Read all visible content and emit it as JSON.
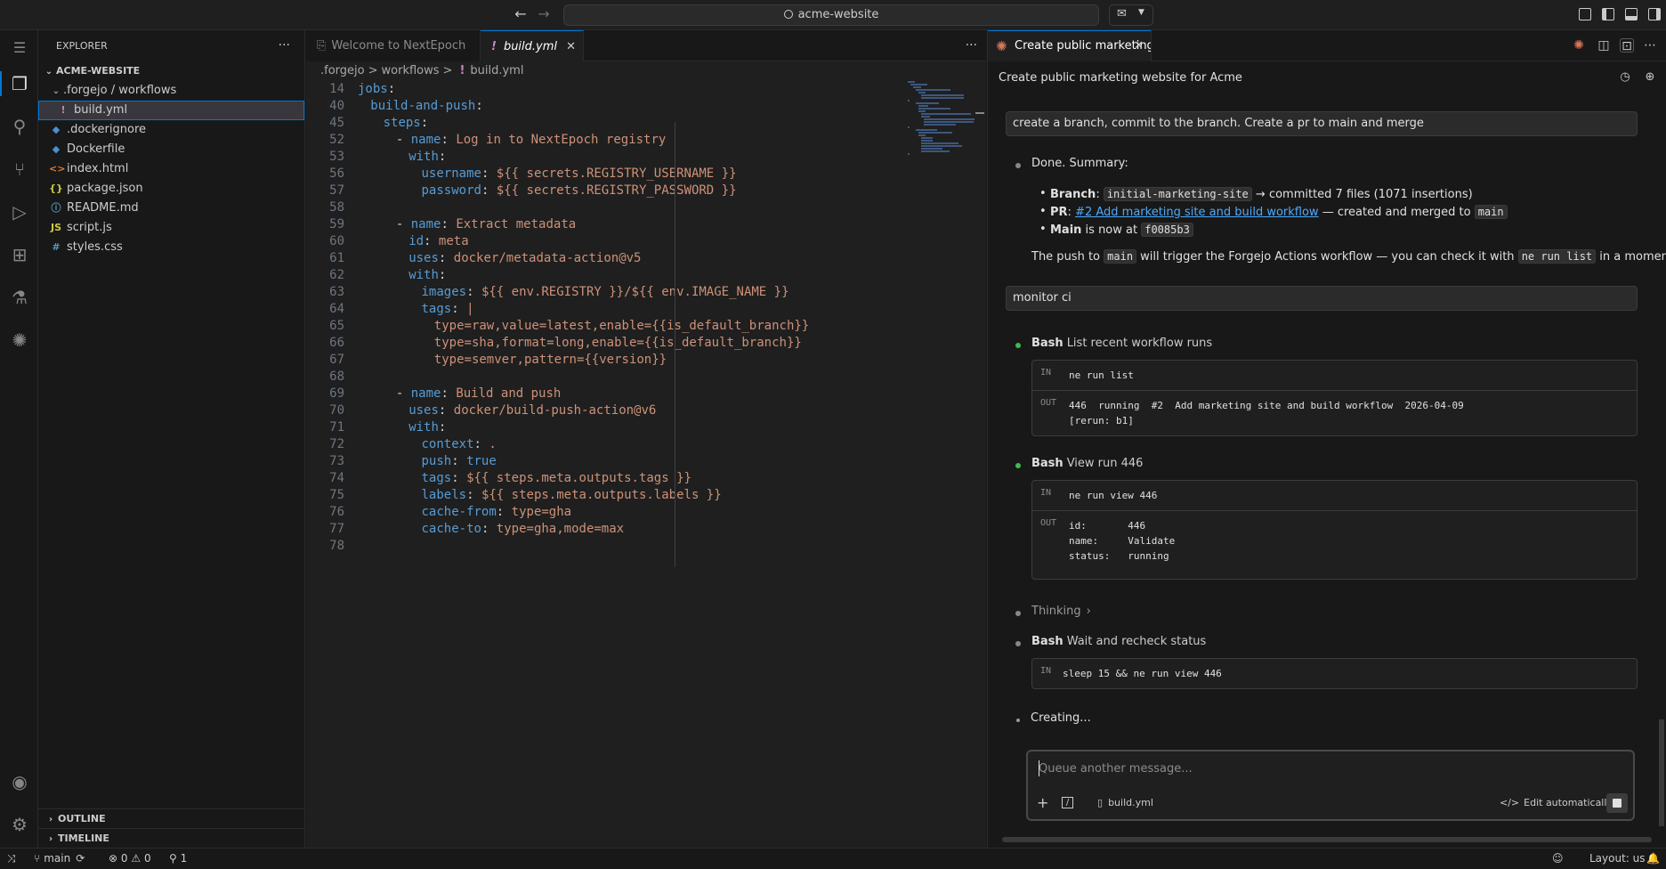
{
  "titlebar": {
    "back_icon": "arrow-left-icon",
    "forward_icon": "arrow-right-icon",
    "search_text": "acme-website"
  },
  "sidebar": {
    "header": "EXPLORER",
    "more_label": "···",
    "root": "ACME-WEBSITE",
    "folder": ".forgejo / workflows",
    "files": [
      {
        "name": "build.yml",
        "icon": "!",
        "color": "#c586c0"
      },
      {
        "name": ".dockerignore",
        "icon": "◆",
        "color": "#4a8fcf"
      },
      {
        "name": "Dockerfile",
        "icon": "◆",
        "color": "#4a8fcf"
      },
      {
        "name": "index.html",
        "icon": "<>",
        "color": "#e37933"
      },
      {
        "name": "package.json",
        "icon": "{}",
        "color": "#cbcb41"
      },
      {
        "name": "README.md",
        "icon": "ⓘ",
        "color": "#519aba"
      },
      {
        "name": "script.js",
        "icon": "JS",
        "color": "#cbcb41"
      },
      {
        "name": "styles.css",
        "icon": "#",
        "color": "#519aba"
      }
    ],
    "outline": "OUTLINE",
    "timeline": "TIMELINE"
  },
  "editor": {
    "tabs": [
      {
        "label": "Welcome to NextEpoch"
      },
      {
        "label": "build.yml"
      }
    ],
    "tab_close": "✕",
    "more_label": "···",
    "breadcrumb": [
      ".forgejo",
      "workflows",
      "build.yml"
    ],
    "breadcrumb_sep": ">",
    "lines": [
      {
        "n": "14",
        "indent": 0,
        "k": "jobs",
        "p": ":",
        "v": ""
      },
      {
        "n": "40",
        "indent": 1,
        "k": "build-and-push",
        "p": ":",
        "v": ""
      },
      {
        "n": "45",
        "indent": 2,
        "k": "steps",
        "p": ":",
        "v": ""
      },
      {
        "n": "52",
        "indent": 3,
        "dash": "- ",
        "k": "name",
        "p": ": ",
        "v": "Log in to NextEpoch registry"
      },
      {
        "n": "53",
        "indent": 4,
        "k": "with",
        "p": ":",
        "v": ""
      },
      {
        "n": "56",
        "indent": 5,
        "k": "username",
        "p": ": ",
        "v": "${{ secrets.REGISTRY_USERNAME }}"
      },
      {
        "n": "57",
        "indent": 5,
        "k": "password",
        "p": ": ",
        "v": "${{ secrets.REGISTRY_PASSWORD }}"
      },
      {
        "n": "58",
        "indent": 0,
        "k": "",
        "p": "",
        "v": ""
      },
      {
        "n": "59",
        "indent": 3,
        "dash": "- ",
        "k": "name",
        "p": ": ",
        "v": "Extract metadata"
      },
      {
        "n": "60",
        "indent": 4,
        "k": "id",
        "p": ": ",
        "v": "meta"
      },
      {
        "n": "61",
        "indent": 4,
        "k": "uses",
        "p": ": ",
        "v": "docker/metadata-action@v5"
      },
      {
        "n": "62",
        "indent": 4,
        "k": "with",
        "p": ":",
        "v": ""
      },
      {
        "n": "63",
        "indent": 5,
        "k": "images",
        "p": ": ",
        "v": "${{ env.REGISTRY }}/${{ env.IMAGE_NAME }}"
      },
      {
        "n": "64",
        "indent": 5,
        "k": "tags",
        "p": ": ",
        "v": "|"
      },
      {
        "n": "65",
        "indent": 6,
        "k": "",
        "p": "",
        "v": "type=raw,value=latest,enable={{is_default_branch}}"
      },
      {
        "n": "66",
        "indent": 6,
        "k": "",
        "p": "",
        "v": "type=sha,format=long,enable={{is_default_branch}}"
      },
      {
        "n": "67",
        "indent": 6,
        "k": "",
        "p": "",
        "v": "type=semver,pattern={{version}}"
      },
      {
        "n": "68",
        "indent": 0,
        "k": "",
        "p": "",
        "v": ""
      },
      {
        "n": "69",
        "indent": 3,
        "dash": "- ",
        "k": "name",
        "p": ": ",
        "v": "Build and push"
      },
      {
        "n": "70",
        "indent": 4,
        "k": "uses",
        "p": ": ",
        "v": "docker/build-push-action@v6"
      },
      {
        "n": "71",
        "indent": 4,
        "k": "with",
        "p": ":",
        "v": ""
      },
      {
        "n": "72",
        "indent": 5,
        "k": "context",
        "p": ": ",
        "v": "."
      },
      {
        "n": "73",
        "indent": 5,
        "k": "push",
        "p": ": ",
        "v": "true",
        "vclass": "blu"
      },
      {
        "n": "74",
        "indent": 5,
        "k": "tags",
        "p": ": ",
        "v": "${{ steps.meta.outputs.tags }}"
      },
      {
        "n": "75",
        "indent": 5,
        "k": "labels",
        "p": ": ",
        "v": "${{ steps.meta.outputs.labels }}"
      },
      {
        "n": "76",
        "indent": 5,
        "k": "cache-from",
        "p": ": ",
        "v": "type=gha"
      },
      {
        "n": "77",
        "indent": 5,
        "k": "cache-to",
        "p": ": ",
        "v": "type=gha,mode=max"
      },
      {
        "n": "78",
        "indent": 0,
        "k": "",
        "p": "",
        "v": ""
      }
    ]
  },
  "chat": {
    "tab_label": "Create public marketing ...",
    "tab_close": "✕",
    "title": "Create public marketing website for Acme",
    "messages": {
      "user1": "create a branch, commit to the branch. Create a pr to main and merge",
      "done_summary": "Done. Summary:",
      "branch_label": "Branch",
      "branch_colon": ": ",
      "branch_code": "initial-marketing-site",
      "branch_rest": " → committed 7 files (1071 insertions)",
      "pr_label": "PR",
      "pr_colon": ": ",
      "pr_link": "#2 Add marketing site and build workflow",
      "pr_rest": " — created and merged to ",
      "pr_code": "main",
      "main_label": "Main",
      "main_rest": " is now at ",
      "main_code": "f0085b3",
      "push_pre": "The push to ",
      "push_code1": "main",
      "push_mid": " will trigger the Forgejo Actions workflow — you can check it with ",
      "push_code2": "ne run list",
      "push_post": " in a moment.",
      "user2": "monitor ci",
      "thinking": "Thinking",
      "creating": "Creating..."
    },
    "tools": [
      {
        "name": "Bash",
        "desc": "List recent workflow runs",
        "in_label": "IN",
        "in": "ne run list",
        "out_label": "OUT",
        "out": [
          "446  running  #2  Add marketing site and build workflow  2026-04-09",
          "[rerun: b1]"
        ]
      },
      {
        "name": "Bash",
        "desc": "View run 446",
        "in_label": "IN",
        "in": "ne run view 446",
        "out_label": "OUT",
        "out": [
          "id:       446",
          "name:     Validate",
          "status:   running"
        ]
      },
      {
        "name": "Bash",
        "desc": "Wait and recheck status",
        "in_label": "IN",
        "in": "sleep 15 && ne run view 446"
      }
    ],
    "input": {
      "placeholder": "Queue another message...",
      "file_chip": "build.yml",
      "edit_mode": "Edit automatically"
    }
  },
  "statusbar": {
    "branch": "main",
    "errors": "0",
    "warnings": "0",
    "ports": "1",
    "layout": "Layout: us"
  },
  "colors": {
    "accent": "#0078d4",
    "claude_orange": "#d97757",
    "success_green": "#3fb950",
    "yaml_key": "#569cd6",
    "yaml_value": "#ce9178"
  }
}
